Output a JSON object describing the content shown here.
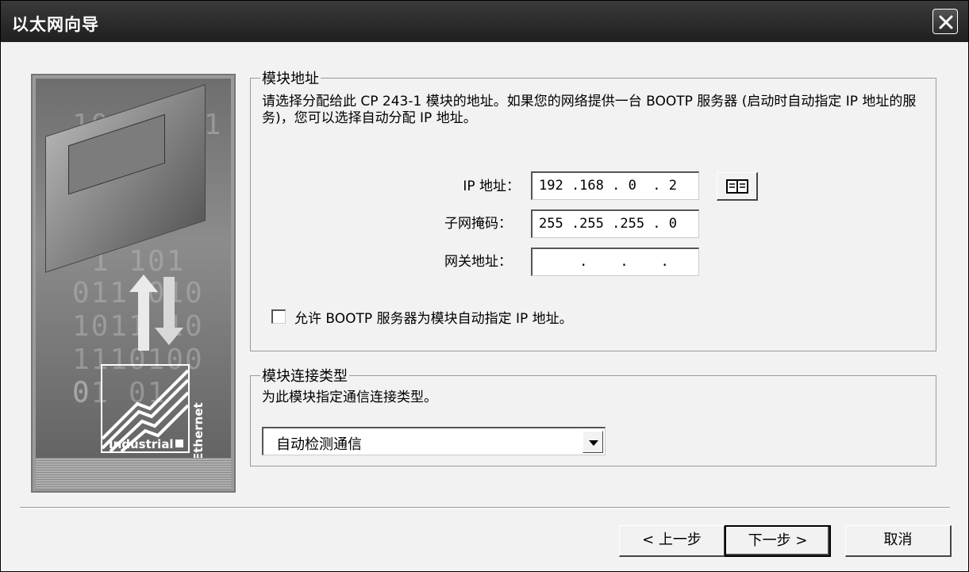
{
  "window": {
    "title": "以太网向导"
  },
  "banner": {
    "binary_rows": [
      "1001 101",
      "1  101",
      "011  010",
      "1011  10",
      "1110100 0",
      "01   01"
    ],
    "ethernet_label": "Ethernet",
    "industrial_label": "Industrial"
  },
  "address_group": {
    "title": "模块地址",
    "description": "请选择分配给此 CP 243-1  模块的地址。如果您的网络提供一台 BOOTP 服务器 (启动时自动指定 IP 地址的服务)，您可以选择自动分配 IP 地址。",
    "ip_label": "IP 地址：",
    "ip_value": "192 .168 . 0  . 2",
    "subnet_label": "子网掩码：",
    "subnet_value": "255 .255 .255 . 0",
    "gateway_label": "网关地址：",
    "gateway_value": "     .    .    .",
    "bootp_checkbox_label": "允许 BOOTP 服务器为模块自动指定 IP 地址。",
    "bootp_checked": false
  },
  "connection_group": {
    "title": "模块连接类型",
    "description": "为此模块指定通信连接类型。",
    "selected": "自动检测通信"
  },
  "buttons": {
    "back": "< 上一步",
    "next": "下一步 >",
    "cancel": "取消"
  }
}
